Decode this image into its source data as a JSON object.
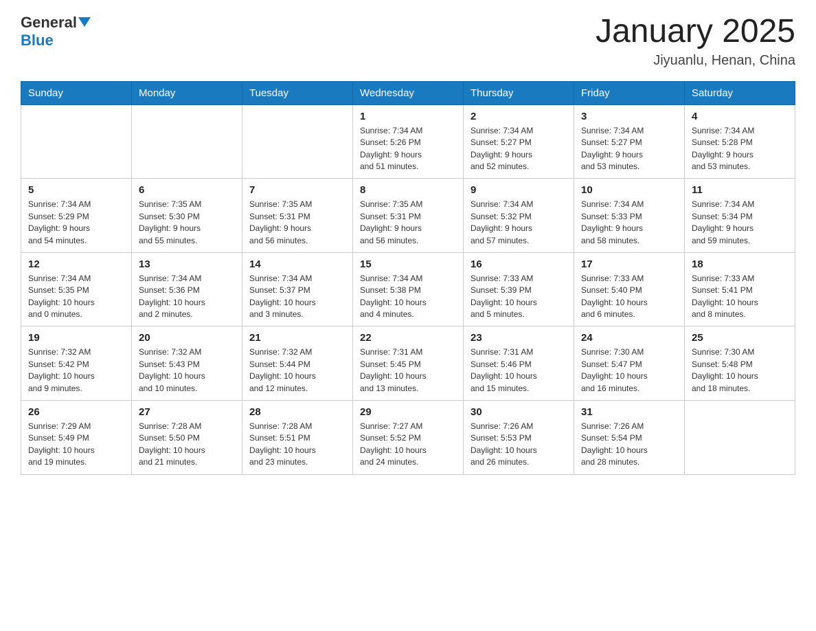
{
  "header": {
    "logo_general": "General",
    "logo_blue": "Blue",
    "month_title": "January 2025",
    "location": "Jiyuanlu, Henan, China"
  },
  "weekdays": [
    "Sunday",
    "Monday",
    "Tuesday",
    "Wednesday",
    "Thursday",
    "Friday",
    "Saturday"
  ],
  "weeks": [
    [
      {
        "day": "",
        "info": ""
      },
      {
        "day": "",
        "info": ""
      },
      {
        "day": "",
        "info": ""
      },
      {
        "day": "1",
        "info": "Sunrise: 7:34 AM\nSunset: 5:26 PM\nDaylight: 9 hours\nand 51 minutes."
      },
      {
        "day": "2",
        "info": "Sunrise: 7:34 AM\nSunset: 5:27 PM\nDaylight: 9 hours\nand 52 minutes."
      },
      {
        "day": "3",
        "info": "Sunrise: 7:34 AM\nSunset: 5:27 PM\nDaylight: 9 hours\nand 53 minutes."
      },
      {
        "day": "4",
        "info": "Sunrise: 7:34 AM\nSunset: 5:28 PM\nDaylight: 9 hours\nand 53 minutes."
      }
    ],
    [
      {
        "day": "5",
        "info": "Sunrise: 7:34 AM\nSunset: 5:29 PM\nDaylight: 9 hours\nand 54 minutes."
      },
      {
        "day": "6",
        "info": "Sunrise: 7:35 AM\nSunset: 5:30 PM\nDaylight: 9 hours\nand 55 minutes."
      },
      {
        "day": "7",
        "info": "Sunrise: 7:35 AM\nSunset: 5:31 PM\nDaylight: 9 hours\nand 56 minutes."
      },
      {
        "day": "8",
        "info": "Sunrise: 7:35 AM\nSunset: 5:31 PM\nDaylight: 9 hours\nand 56 minutes."
      },
      {
        "day": "9",
        "info": "Sunrise: 7:34 AM\nSunset: 5:32 PM\nDaylight: 9 hours\nand 57 minutes."
      },
      {
        "day": "10",
        "info": "Sunrise: 7:34 AM\nSunset: 5:33 PM\nDaylight: 9 hours\nand 58 minutes."
      },
      {
        "day": "11",
        "info": "Sunrise: 7:34 AM\nSunset: 5:34 PM\nDaylight: 9 hours\nand 59 minutes."
      }
    ],
    [
      {
        "day": "12",
        "info": "Sunrise: 7:34 AM\nSunset: 5:35 PM\nDaylight: 10 hours\nand 0 minutes."
      },
      {
        "day": "13",
        "info": "Sunrise: 7:34 AM\nSunset: 5:36 PM\nDaylight: 10 hours\nand 2 minutes."
      },
      {
        "day": "14",
        "info": "Sunrise: 7:34 AM\nSunset: 5:37 PM\nDaylight: 10 hours\nand 3 minutes."
      },
      {
        "day": "15",
        "info": "Sunrise: 7:34 AM\nSunset: 5:38 PM\nDaylight: 10 hours\nand 4 minutes."
      },
      {
        "day": "16",
        "info": "Sunrise: 7:33 AM\nSunset: 5:39 PM\nDaylight: 10 hours\nand 5 minutes."
      },
      {
        "day": "17",
        "info": "Sunrise: 7:33 AM\nSunset: 5:40 PM\nDaylight: 10 hours\nand 6 minutes."
      },
      {
        "day": "18",
        "info": "Sunrise: 7:33 AM\nSunset: 5:41 PM\nDaylight: 10 hours\nand 8 minutes."
      }
    ],
    [
      {
        "day": "19",
        "info": "Sunrise: 7:32 AM\nSunset: 5:42 PM\nDaylight: 10 hours\nand 9 minutes."
      },
      {
        "day": "20",
        "info": "Sunrise: 7:32 AM\nSunset: 5:43 PM\nDaylight: 10 hours\nand 10 minutes."
      },
      {
        "day": "21",
        "info": "Sunrise: 7:32 AM\nSunset: 5:44 PM\nDaylight: 10 hours\nand 12 minutes."
      },
      {
        "day": "22",
        "info": "Sunrise: 7:31 AM\nSunset: 5:45 PM\nDaylight: 10 hours\nand 13 minutes."
      },
      {
        "day": "23",
        "info": "Sunrise: 7:31 AM\nSunset: 5:46 PM\nDaylight: 10 hours\nand 15 minutes."
      },
      {
        "day": "24",
        "info": "Sunrise: 7:30 AM\nSunset: 5:47 PM\nDaylight: 10 hours\nand 16 minutes."
      },
      {
        "day": "25",
        "info": "Sunrise: 7:30 AM\nSunset: 5:48 PM\nDaylight: 10 hours\nand 18 minutes."
      }
    ],
    [
      {
        "day": "26",
        "info": "Sunrise: 7:29 AM\nSunset: 5:49 PM\nDaylight: 10 hours\nand 19 minutes."
      },
      {
        "day": "27",
        "info": "Sunrise: 7:28 AM\nSunset: 5:50 PM\nDaylight: 10 hours\nand 21 minutes."
      },
      {
        "day": "28",
        "info": "Sunrise: 7:28 AM\nSunset: 5:51 PM\nDaylight: 10 hours\nand 23 minutes."
      },
      {
        "day": "29",
        "info": "Sunrise: 7:27 AM\nSunset: 5:52 PM\nDaylight: 10 hours\nand 24 minutes."
      },
      {
        "day": "30",
        "info": "Sunrise: 7:26 AM\nSunset: 5:53 PM\nDaylight: 10 hours\nand 26 minutes."
      },
      {
        "day": "31",
        "info": "Sunrise: 7:26 AM\nSunset: 5:54 PM\nDaylight: 10 hours\nand 28 minutes."
      },
      {
        "day": "",
        "info": ""
      }
    ]
  ]
}
